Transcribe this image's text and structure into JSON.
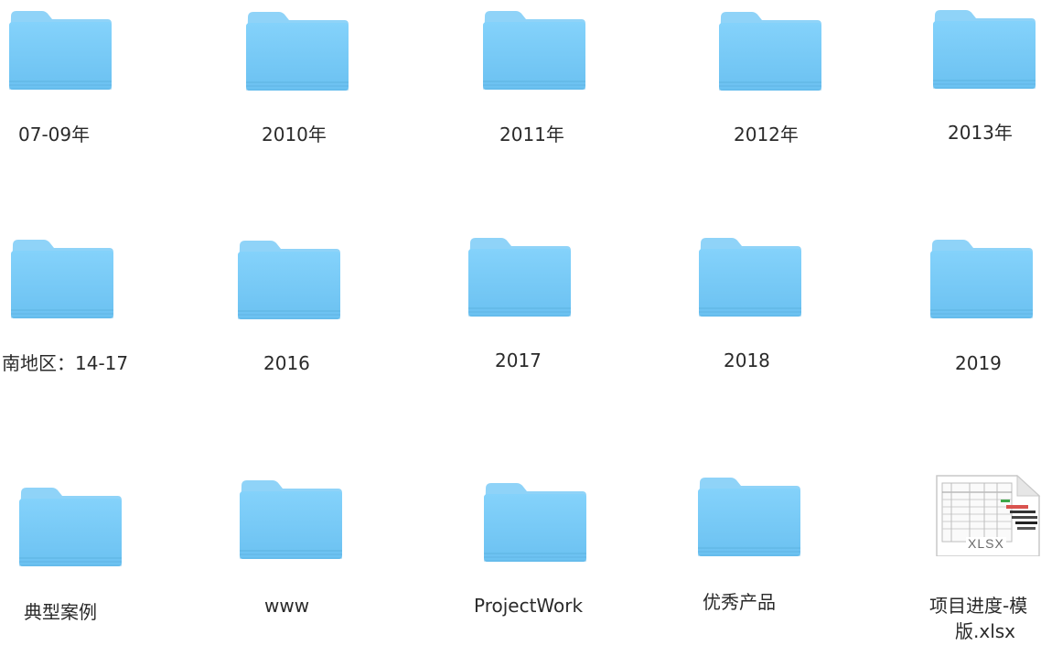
{
  "items": [
    {
      "name": "07-09年",
      "icon": "folder-icon"
    },
    {
      "name": "2010年",
      "icon": "folder-icon"
    },
    {
      "name": "2011年",
      "icon": "folder-icon"
    },
    {
      "name": "2012年",
      "icon": "folder-icon"
    },
    {
      "name": "2013年",
      "icon": "folder-icon"
    },
    {
      "name": "南地区：14-17",
      "icon": "folder-icon"
    },
    {
      "name": "2016",
      "icon": "folder-icon"
    },
    {
      "name": "2017",
      "icon": "folder-icon"
    },
    {
      "name": "2018",
      "icon": "folder-icon"
    },
    {
      "name": "2019",
      "icon": "folder-icon"
    },
    {
      "name": "典型案例",
      "icon": "folder-icon"
    },
    {
      "name": "www",
      "icon": "folder-icon"
    },
    {
      "name": "ProjectWork",
      "icon": "folder-icon"
    },
    {
      "name": "优秀产品",
      "icon": "folder-icon"
    },
    {
      "name_line1": "项目进度-模",
      "name_line2": "版.xlsx",
      "icon": "xlsx-file-icon",
      "badge": "XLSX"
    }
  ],
  "colors": {
    "folder_body": "#74c8f5",
    "folder_tab": "#8fd3f8",
    "folder_shadow": "#5fb4e2"
  }
}
